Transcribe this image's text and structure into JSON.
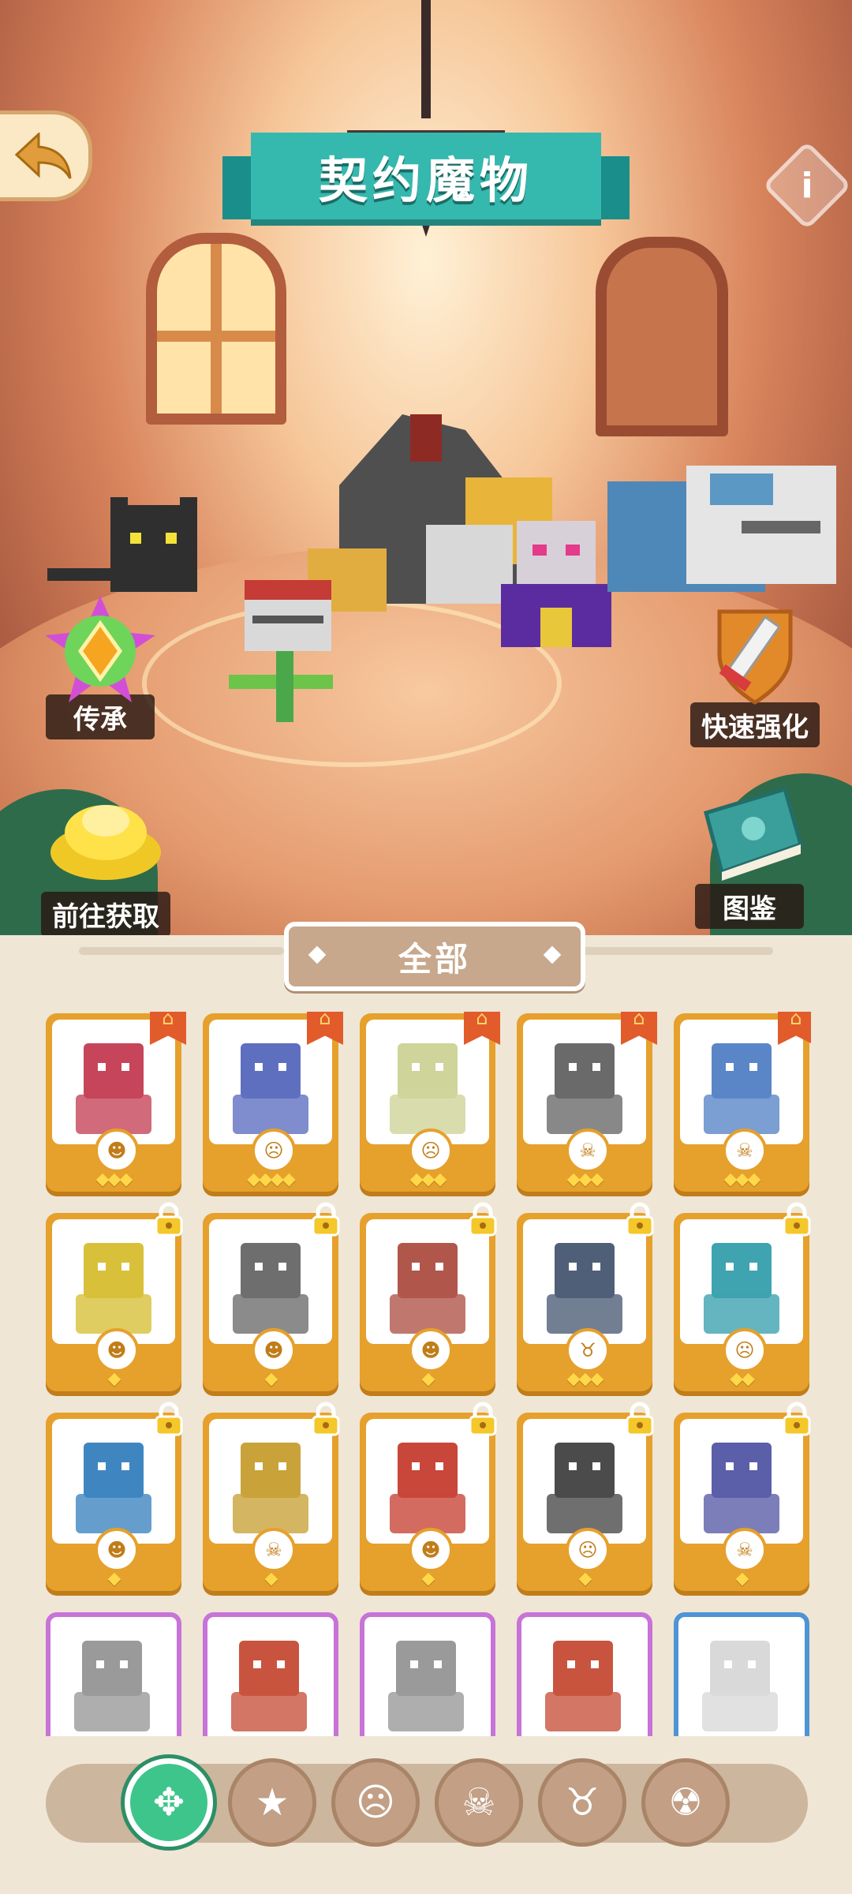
{
  "header": {
    "title": "契约魔物",
    "back_icon": "back-arrow-icon",
    "info_label": "i"
  },
  "actions": {
    "inherit": {
      "label": "传承",
      "icon": "inherit-crystal-icon"
    },
    "quick_upgrade": {
      "label": "快速强化",
      "icon": "sword-shield-icon"
    },
    "obtain": {
      "label": "前往获取",
      "icon": "gold-pile-icon"
    },
    "codex": {
      "label": "图鉴",
      "icon": "book-icon"
    }
  },
  "filter": {
    "label": "全部"
  },
  "cards": [
    {
      "frame": "gold",
      "badge": "flag",
      "emblem": "brute-face-icon",
      "stars": 3
    },
    {
      "frame": "gold",
      "badge": "flag",
      "emblem": "ogre-face-icon",
      "stars": 4
    },
    {
      "frame": "gold",
      "badge": "flag",
      "emblem": "ogre-face-icon",
      "stars": 3
    },
    {
      "frame": "gold",
      "badge": "flag",
      "emblem": "flame-skull-icon",
      "stars": 3
    },
    {
      "frame": "gold",
      "badge": "flag",
      "emblem": "flame-skull-icon",
      "stars": 3
    },
    {
      "frame": "gold",
      "badge": "lock",
      "emblem": "brute-face-icon",
      "stars": 1
    },
    {
      "frame": "gold",
      "badge": "lock",
      "emblem": "brute-face-icon",
      "stars": 1
    },
    {
      "frame": "gold",
      "badge": "lock",
      "emblem": "brute-face-icon",
      "stars": 1
    },
    {
      "frame": "gold",
      "badge": "lock",
      "emblem": "horned-mask-icon",
      "stars": 3
    },
    {
      "frame": "gold",
      "badge": "lock",
      "emblem": "ogre-face-icon",
      "stars": 2
    },
    {
      "frame": "gold",
      "badge": "lock",
      "emblem": "brute-face-icon",
      "stars": 1
    },
    {
      "frame": "gold",
      "badge": "lock",
      "emblem": "flame-skull-icon",
      "stars": 1
    },
    {
      "frame": "gold",
      "badge": "lock",
      "emblem": "brute-face-icon",
      "stars": 1
    },
    {
      "frame": "gold",
      "badge": "lock",
      "emblem": "ogre-face-icon",
      "stars": 1
    },
    {
      "frame": "gold",
      "badge": "lock",
      "emblem": "flame-skull-icon",
      "stars": 1
    },
    {
      "frame": "purple",
      "badge": "none",
      "emblem": "",
      "stars": 0
    },
    {
      "frame": "purple",
      "badge": "none",
      "emblem": "",
      "stars": 0
    },
    {
      "frame": "purple",
      "badge": "none",
      "emblem": "",
      "stars": 0
    },
    {
      "frame": "purple",
      "badge": "none",
      "emblem": "",
      "stars": 0
    },
    {
      "frame": "blue",
      "badge": "none",
      "emblem": "",
      "stars": 0
    }
  ],
  "nav_tabs": [
    {
      "icon": "all-diamonds-icon",
      "active": true
    },
    {
      "icon": "star-egg-icon",
      "active": false
    },
    {
      "icon": "ogre-face-icon",
      "active": false
    },
    {
      "icon": "flame-skull-icon",
      "active": false
    },
    {
      "icon": "horned-mask-icon",
      "active": false
    },
    {
      "icon": "demon-face-icon",
      "active": false
    }
  ],
  "colors": {
    "teal_banner": "#35b8ae",
    "gold_card": "#e6a02c",
    "purple_card": "#c773d8",
    "blue_card": "#4f94d4",
    "active_tab": "#3ec58b"
  }
}
